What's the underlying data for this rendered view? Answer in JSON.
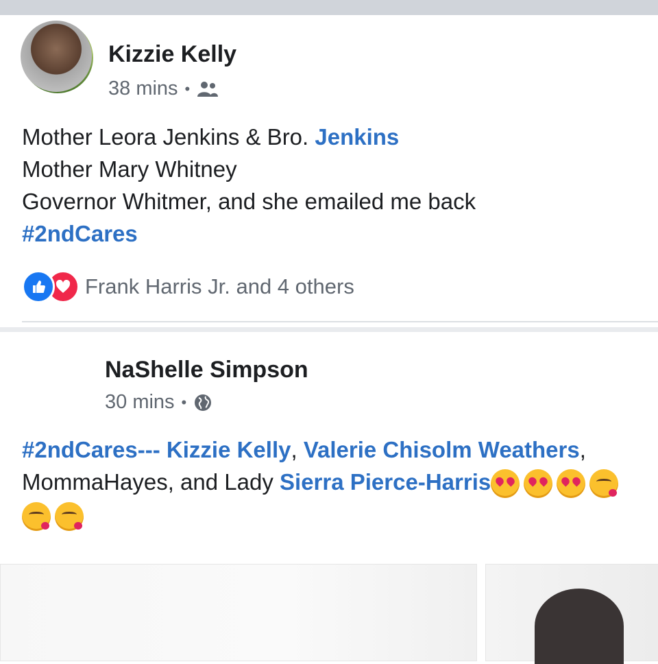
{
  "posts": [
    {
      "author": "Kizzie Kelly",
      "time": "38 mins",
      "audience_icon": "friends-icon",
      "lines": [
        {
          "text": "Mother Leora Jenkins & Bro. ",
          "link": "Jenkins"
        },
        {
          "text": "Mother Mary  Whitney"
        },
        {
          "text": "Governor Whitmer, and she emailed me back"
        },
        {
          "link": "#2ndCares"
        }
      ],
      "reactions": {
        "icons": [
          "like-icon",
          "love-icon"
        ],
        "text": "Frank Harris Jr. and 4 others"
      }
    },
    {
      "author": "NaShelle Simpson",
      "time": "30 mins",
      "audience_icon": "globe-icon",
      "line1": {
        "tag": "#2ndCares---",
        "mention1": "Kizzie Kelly",
        "comma1": ",",
        "mention2": "Valerie Chisolm Weathers",
        "comma2": ","
      },
      "line2": {
        "text": "MommaHayes, and Lady ",
        "mention": "Sierra Pierce-Harris"
      },
      "emojis_line2": [
        "heart-eyes-emoji",
        "heart-eyes-emoji",
        "heart-eyes-emoji",
        "kissing-heart-emoji"
      ],
      "emojis_line3": [
        "kissing-heart-emoji",
        "kissing-heart-emoji"
      ]
    }
  ],
  "colors": {
    "link": "#2d70c4",
    "like": "#1877f2",
    "love": "#f0284a",
    "meta": "#606770"
  }
}
